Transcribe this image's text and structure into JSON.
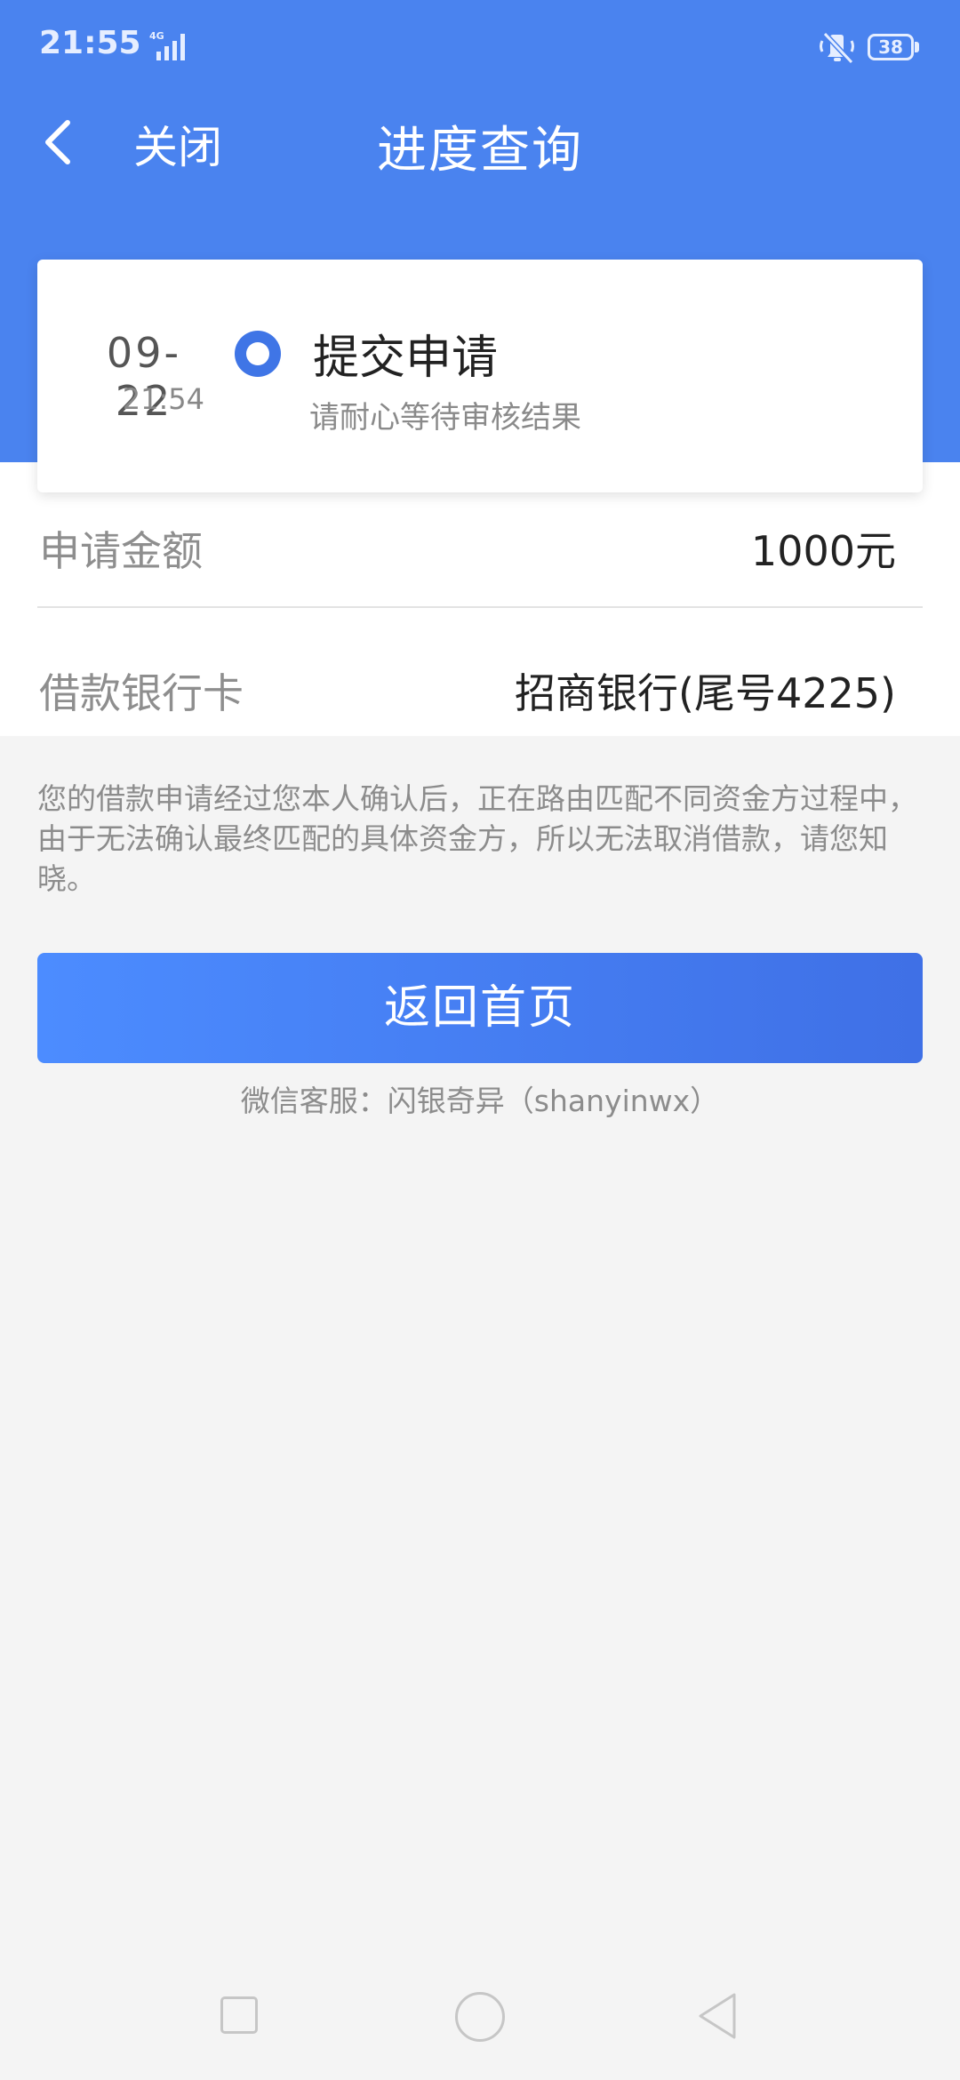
{
  "status_bar": {
    "time": "21:55",
    "network": "4G",
    "battery": "38"
  },
  "nav": {
    "close_label": "关闭",
    "title": "进度查询"
  },
  "progress": {
    "date": "09-22",
    "time": "21:54",
    "status": "提交申请",
    "hint": "请耐心等待审核结果"
  },
  "info": {
    "amount_label": "申请金额",
    "amount_value": "1000元",
    "bank_label": "借款银行卡",
    "bank_value": "招商银行(尾号4225)"
  },
  "notice": "您的借款申请经过您本人确认后，正在路由匹配不同资金方过程中，由于无法确认最终匹配的具体资金方，所以无法取消借款，请您知晓。",
  "home_button": "返回首页",
  "service": "微信客服：闪银奇异（shanyinwx）",
  "colors": {
    "header": "#4a83ef",
    "accent": "#3f75e6",
    "background": "#f4f4f4"
  }
}
